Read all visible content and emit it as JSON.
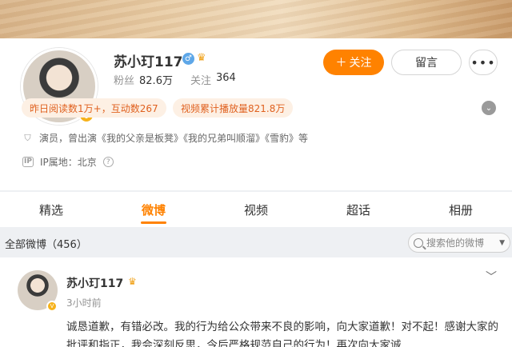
{
  "profile": {
    "name": "苏小玎117",
    "avatar_badge": "V",
    "followers_label": "粉丝",
    "followers_value": "82.6万",
    "following_label": "关注",
    "following_value": "364",
    "follow_button": "关注",
    "message_button": "留言",
    "more_button": "•••",
    "highlight_reads": "昨日阅读数1万+，互动数267",
    "highlight_video": "视频累计播放量821.8万",
    "bio": "演员，曾出演《我的父亲是板凳》《我的兄弟叫顺溜》《雪豹》等",
    "ip_label": "IP属地：北京",
    "icons": [
      "male-icon",
      "crown-icon",
      "plus-icon",
      "expand-icon",
      "badge-icon",
      "ip-icon",
      "help-icon"
    ]
  },
  "tabs": [
    {
      "label": "精选"
    },
    {
      "label": "微博"
    },
    {
      "label": "视频"
    },
    {
      "label": "超话"
    },
    {
      "label": "相册"
    }
  ],
  "filter": {
    "all_posts": "全部微博（456）",
    "search_placeholder": "搜索他的微博"
  },
  "post": {
    "author": "苏小玎117",
    "time": "3小时前",
    "text": "诚恳道歉，有错必改。我的行为给公众带来不良的影响，向大家道歉！对不起！感谢大家的批评和指正，我会深刻反思，今后严格规范自己的行为！再次向大家诚"
  },
  "colors": {
    "accent": "#ff8200",
    "highlight_text": "#e0611f",
    "highlight_bg": "#fdf0e4",
    "badge": "#f6b21b"
  }
}
